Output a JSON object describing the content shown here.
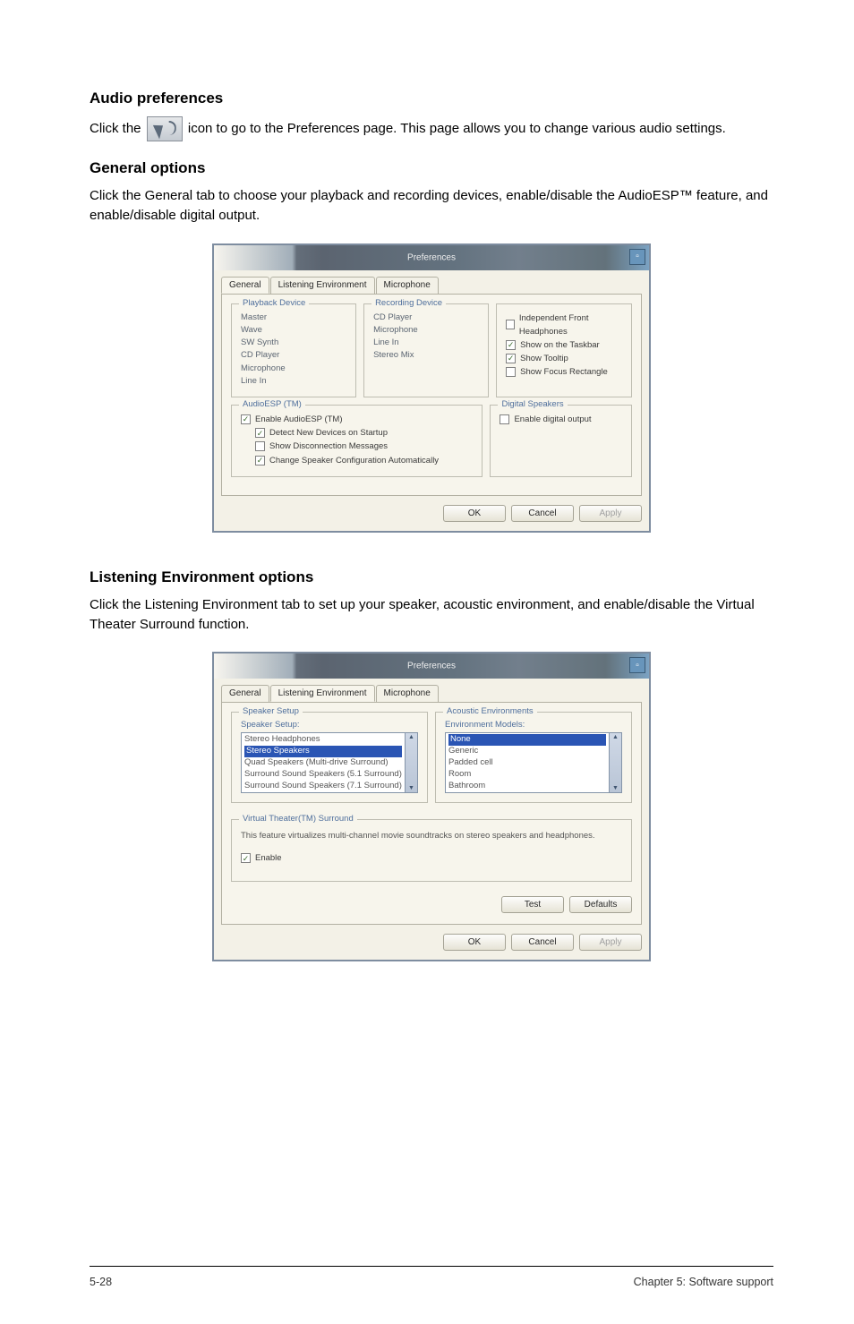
{
  "section_audio_prefs": {
    "heading": "Audio preferences",
    "body_before": "Click the ",
    "body_after": " icon to go to the Preferences page. This page allows you to change various audio settings."
  },
  "section_general": {
    "heading": "General options",
    "body": "Click the General tab to choose your playback and recording devices, enable/disable the AudioESP™ feature, and enable/disable digital output."
  },
  "section_listening": {
    "heading": "Listening Environment options",
    "body": "Click the Listening Environment tab to set up your speaker, acoustic environment, and enable/disable the Virtual Theater Surround function."
  },
  "window": {
    "title": "Preferences",
    "close_glyph": "▫",
    "tabs": {
      "general": "General",
      "listening": "Listening Environment",
      "microphone": "Microphone"
    }
  },
  "general_tab": {
    "playback": {
      "legend": "Playback Device",
      "items": [
        "Master",
        "Wave",
        "SW Synth",
        "CD Player",
        "Microphone",
        "Line In"
      ]
    },
    "recording": {
      "legend": "Recording Device",
      "items": [
        "CD Player",
        "Microphone",
        "Line In",
        "Stereo Mix"
      ]
    },
    "others": {
      "legend": "",
      "items": [
        {
          "checked": false,
          "label": "Independent Front Headphones"
        },
        {
          "checked": true,
          "label": "Show on the Taskbar"
        },
        {
          "checked": true,
          "label": "Show Tooltip"
        },
        {
          "checked": false,
          "label": "Show Focus Rectangle"
        }
      ]
    },
    "audioesp": {
      "legend": "AudioESP (TM)",
      "items": [
        {
          "checked": true,
          "label": "Enable AudioESP (TM)"
        },
        {
          "checked": true,
          "label": "Detect New Devices on Startup",
          "indent": true
        },
        {
          "checked": false,
          "label": "Show Disconnection Messages",
          "indent": true
        },
        {
          "checked": true,
          "label": "Change Speaker Configuration Automatically",
          "indent": true
        }
      ]
    },
    "digital": {
      "legend": "Digital Speakers",
      "item": {
        "checked": false,
        "label": "Enable digital output"
      }
    },
    "buttons": {
      "ok": "OK",
      "cancel": "Cancel",
      "apply": "Apply"
    }
  },
  "listening_tab": {
    "speaker_setup": {
      "legend": "Speaker Setup",
      "label": "Speaker Setup:",
      "options": [
        {
          "text": "Stereo Headphones",
          "selected": false
        },
        {
          "text": "Stereo Speakers",
          "selected": true
        },
        {
          "text": "Quad Speakers (Multi-drive Surround)",
          "selected": false
        },
        {
          "text": "Surround Sound Speakers (5.1 Surround)",
          "selected": false
        },
        {
          "text": "Surround Sound Speakers (7.1 Surround)",
          "selected": false
        }
      ]
    },
    "acoustic_env": {
      "legend": "Acoustic Environments",
      "label": "Environment Models:",
      "options": [
        {
          "text": "None",
          "selected": true
        },
        {
          "text": "Generic",
          "selected": false
        },
        {
          "text": "Padded cell",
          "selected": false
        },
        {
          "text": "Room",
          "selected": false
        },
        {
          "text": "Bathroom",
          "selected": false
        }
      ]
    },
    "virtual_theater": {
      "legend": "Virtual Theater(TM) Surround",
      "desc": "This feature virtualizes multi-channel movie soundtracks on stereo speakers and headphones.",
      "enable": {
        "checked": true,
        "label": "Enable"
      }
    },
    "buttons": {
      "test": "Test",
      "defaults": "Defaults",
      "ok": "OK",
      "cancel": "Cancel",
      "apply": "Apply"
    }
  },
  "footer": {
    "left": "5-28",
    "right": "Chapter 5: Software support"
  }
}
